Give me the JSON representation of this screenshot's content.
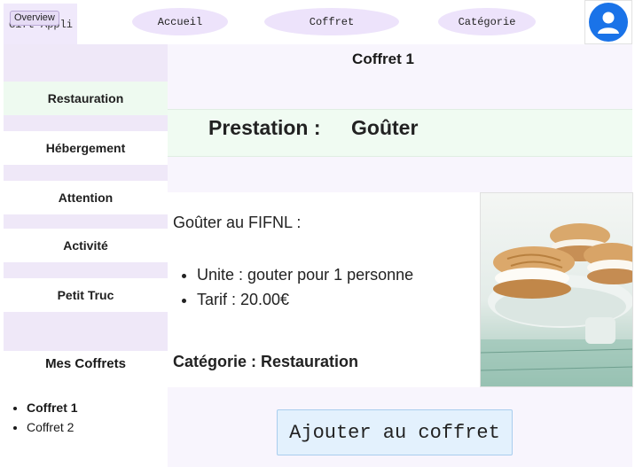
{
  "header": {
    "overview_badge": "Overview",
    "app_name": "Gift Appli",
    "nav": [
      {
        "label": "Accueil"
      },
      {
        "label": "Coffret"
      },
      {
        "label": "Catégorie"
      }
    ],
    "avatar_icon": "user-icon",
    "accent_color": "#1a73e8"
  },
  "sidebar": {
    "categories": [
      {
        "label": "Restauration",
        "active": true
      },
      {
        "label": "Hébergement"
      },
      {
        "label": "Attention"
      },
      {
        "label": "Activité"
      },
      {
        "label": "Petit Truc"
      }
    ],
    "my_boxes_title": "Mes Coffrets",
    "my_boxes": [
      {
        "label": "Coffret 1",
        "current": true
      },
      {
        "label": "Coffret 2"
      }
    ]
  },
  "main": {
    "coffret_title": "Coffret 1",
    "prestation_label": "Prestation :",
    "prestation_name": "Goûter",
    "detail": {
      "name": "Goûter au FIFNL :",
      "unit": "Unite : gouter pour 1 personne",
      "price": "Tarif : 20.00€",
      "category": "Catégorie : Restauration"
    },
    "image_icon": "cookies-photo",
    "add_button": "Ajouter au coffret"
  }
}
